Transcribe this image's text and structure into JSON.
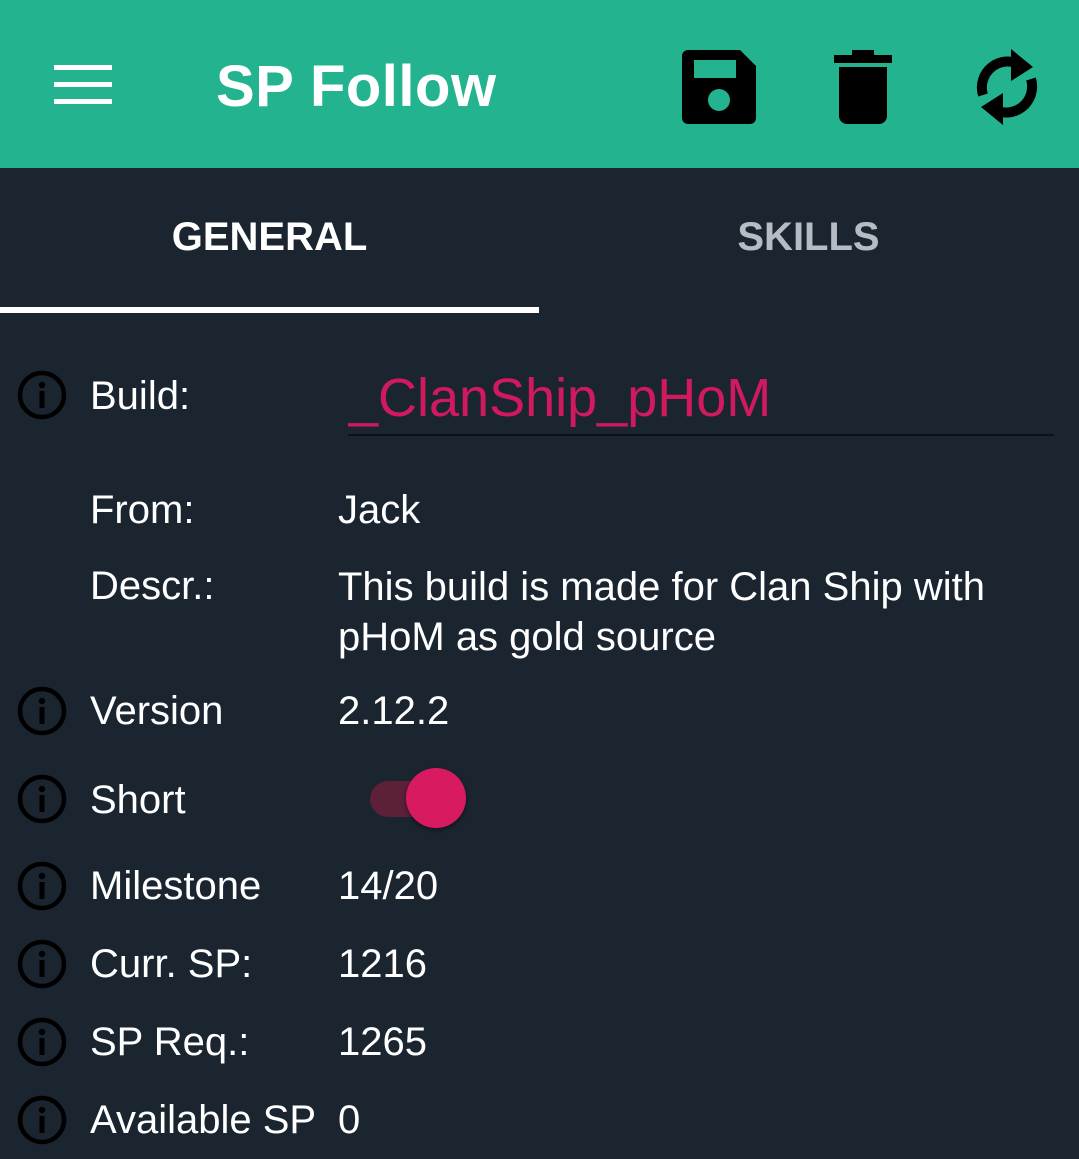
{
  "app": {
    "title": "SP Follow"
  },
  "toolbar": {
    "menu_icon": "hamburger-menu-icon",
    "save_icon": "floppy-disk-icon",
    "delete_icon": "trash-icon",
    "refresh_icon": "refresh-icon"
  },
  "tabs": [
    {
      "label": "GENERAL",
      "selected": true
    },
    {
      "label": "SKILLS",
      "selected": false
    }
  ],
  "fields": {
    "build": {
      "label": "Build:",
      "value": "_ClanShip_pHoM"
    },
    "from": {
      "label": "From:",
      "value": "Jack"
    },
    "descr": {
      "label": "Descr.:",
      "value": "This build is made for Clan Ship with pHoM as gold source"
    },
    "version": {
      "label": "Version",
      "value": "2.12.2"
    },
    "short": {
      "label": "Short",
      "checked": true
    },
    "milestone": {
      "label": "Milestone",
      "value": "14/20"
    },
    "curr_sp": {
      "label": "Curr. SP:",
      "value": "1216"
    },
    "sp_req": {
      "label": "SP Req.:",
      "value": "1265"
    },
    "available_sp": {
      "label": "Available SP",
      "value": "0"
    }
  },
  "colors": {
    "appbar": "#23b38f",
    "background": "#1b2530",
    "accent": "#d81b60"
  }
}
